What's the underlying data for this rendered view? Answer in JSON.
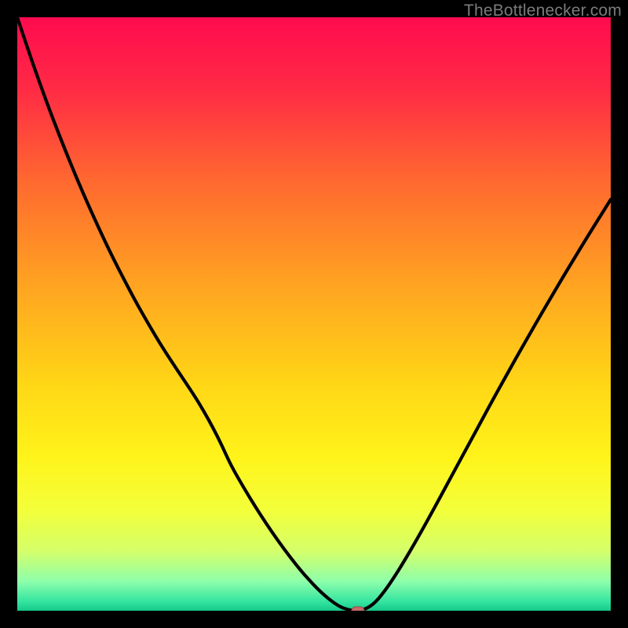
{
  "watermark": "TheBottlenecker.com",
  "colors": {
    "frame": "#000000",
    "curve": "#000000",
    "marker_fill": "#c66a6a",
    "marker_stroke": "#9b4a4a",
    "gradient_stops": [
      {
        "offset": 0.0,
        "color": "#ff0b4f"
      },
      {
        "offset": 0.12,
        "color": "#ff2a45"
      },
      {
        "offset": 0.28,
        "color": "#ff6a2f"
      },
      {
        "offset": 0.45,
        "color": "#ffa321"
      },
      {
        "offset": 0.62,
        "color": "#ffd716"
      },
      {
        "offset": 0.74,
        "color": "#fff31a"
      },
      {
        "offset": 0.83,
        "color": "#f3ff3a"
      },
      {
        "offset": 0.9,
        "color": "#d4ff6a"
      },
      {
        "offset": 0.95,
        "color": "#8fffab"
      },
      {
        "offset": 0.985,
        "color": "#33e4a0"
      },
      {
        "offset": 1.0,
        "color": "#16c98a"
      }
    ]
  },
  "chart_data": {
    "type": "line",
    "title": "",
    "xlabel": "",
    "ylabel": "",
    "xlim": [
      0,
      100
    ],
    "ylim": [
      0,
      100
    ],
    "grid": false,
    "legend": false,
    "x": [
      0,
      2,
      4,
      6,
      8,
      10,
      12,
      14,
      16,
      18,
      20,
      22,
      24,
      26,
      28,
      30,
      31.5,
      33,
      34.5,
      36,
      38,
      40,
      42,
      44,
      46,
      48,
      49,
      50,
      51,
      52,
      53,
      54,
      55,
      56.5,
      58,
      60,
      62,
      64,
      66,
      68,
      70,
      72,
      74,
      76,
      78,
      80,
      82,
      84,
      86,
      88,
      90,
      92,
      94,
      96,
      98,
      100
    ],
    "y": [
      100.0,
      94.0,
      88.3,
      82.9,
      77.8,
      72.9,
      68.3,
      63.9,
      59.7,
      55.8,
      52.0,
      48.5,
      45.1,
      42.0,
      39.0,
      36.0,
      33.5,
      30.8,
      27.8,
      24.5,
      21.0,
      17.7,
      14.6,
      11.7,
      9.0,
      6.5,
      5.4,
      4.3,
      3.3,
      2.4,
      1.6,
      0.9,
      0.4,
      0.0,
      0.0,
      1.0,
      3.4,
      6.4,
      9.7,
      13.2,
      16.8,
      20.5,
      24.2,
      27.9,
      31.6,
      35.3,
      38.9,
      42.5,
      46.0,
      49.5,
      52.9,
      56.3,
      59.6,
      62.9,
      66.1,
      69.3
    ],
    "marker": {
      "x": 57.4,
      "y": 0.0
    }
  }
}
